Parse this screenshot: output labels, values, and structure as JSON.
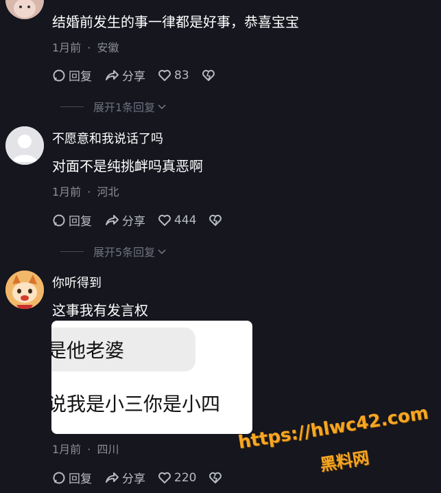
{
  "comments": [
    {
      "text": "结婚前发生的事一律都是好事，恭喜宝宝",
      "time": "1月前",
      "location": "安徽",
      "reply_label": "回复",
      "share_label": "分享",
      "likes": "83",
      "expand_label": "展开1条回复"
    },
    {
      "username": "不愿意和我说话了吗",
      "text": "对面不是纯挑衅吗真恶啊",
      "time": "1月前",
      "location": "河北",
      "reply_label": "回复",
      "share_label": "分享",
      "likes": "444",
      "expand_label": "展开5条回复"
    },
    {
      "username": "你听得到",
      "text": "这事我有发言权",
      "image_lines": [
        "是他老婆",
        "说我是小三你是小四"
      ],
      "time": "1月前",
      "location": "四川",
      "reply_label": "回复",
      "share_label": "分享",
      "likes": "220"
    }
  ],
  "meta_separator": "·",
  "watermark": {
    "url": "https://hlwc42.com",
    "site": "黑料网"
  },
  "colors": {
    "background": "#15161e",
    "watermark": "#f6a623"
  },
  "icons": [
    "comment-icon",
    "share-icon",
    "heart-icon",
    "dislike-heart-icon",
    "chevron-down-icon",
    "default-avatar-icon"
  ]
}
